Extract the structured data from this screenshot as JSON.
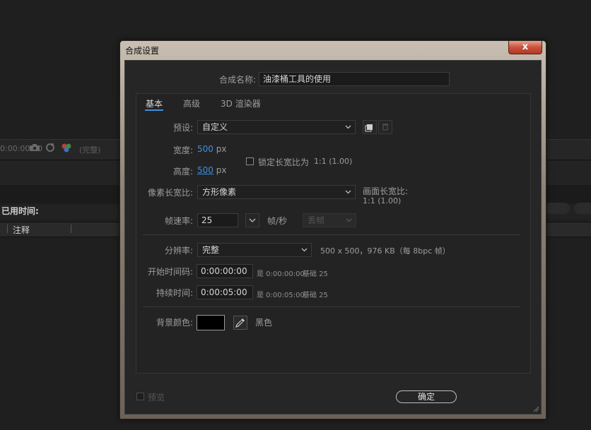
{
  "background": {
    "timecode": "0:00:00:00",
    "resolution": "(完整)",
    "elapsed_label": "已用时间:",
    "comments_label": "注释"
  },
  "dialog": {
    "title": "合成设置",
    "close_glyph": "x",
    "comp_name_label": "合成名称:",
    "comp_name_value": "油漆桶工具的使用",
    "tabs": [
      {
        "label": "基本",
        "active": true
      },
      {
        "label": "高级",
        "active": false
      },
      {
        "label": "3D 渲染器",
        "active": false
      }
    ],
    "preset": {
      "label": "预设:",
      "value": "自定义"
    },
    "width": {
      "label": "宽度:",
      "value": "500",
      "unit": "px"
    },
    "height": {
      "label": "高度:",
      "value": "500",
      "unit": "px"
    },
    "lock_aspect": {
      "label": "锁定长宽比为",
      "ratio": "1:1 (1.00)",
      "checked": false
    },
    "pixel_aspect": {
      "label": "像素长宽比:",
      "value": "方形像素"
    },
    "frame_aspect": {
      "label": "画面长宽比:",
      "value": "1:1 (1.00)"
    },
    "frame_rate": {
      "label": "帧速率:",
      "value": "25",
      "unit": "帧/秒",
      "drop_frame": "丢帧"
    },
    "resolution": {
      "label": "分辨率:",
      "value": "完整",
      "info": "500 x 500，976 KB（每 8bpc 帧）"
    },
    "start_timecode": {
      "label": "开始时间码:",
      "value": "0:00:00:00",
      "is_text": "是 0:00:00:00",
      "base_text": "基础 25"
    },
    "duration": {
      "label": "持续时间:",
      "value": "0:00:05:00",
      "is_text": "是 0:00:05:00",
      "base_text": "基础 25"
    },
    "bg_color": {
      "label": "背景颜色:",
      "swatch": "#000000",
      "name": "黑色"
    },
    "preview": {
      "label": "预览",
      "checked": false
    },
    "ok_label": "确定"
  },
  "colors": {
    "accent": "#3f8fe0",
    "dialog_bg": "#262626",
    "close_button": "#c9523d"
  },
  "icons": {
    "preset_save": "save-preset-icon",
    "preset_delete": "trash-icon",
    "eyedropper": "eyedropper-icon",
    "chevron": "chevron-down-icon"
  }
}
